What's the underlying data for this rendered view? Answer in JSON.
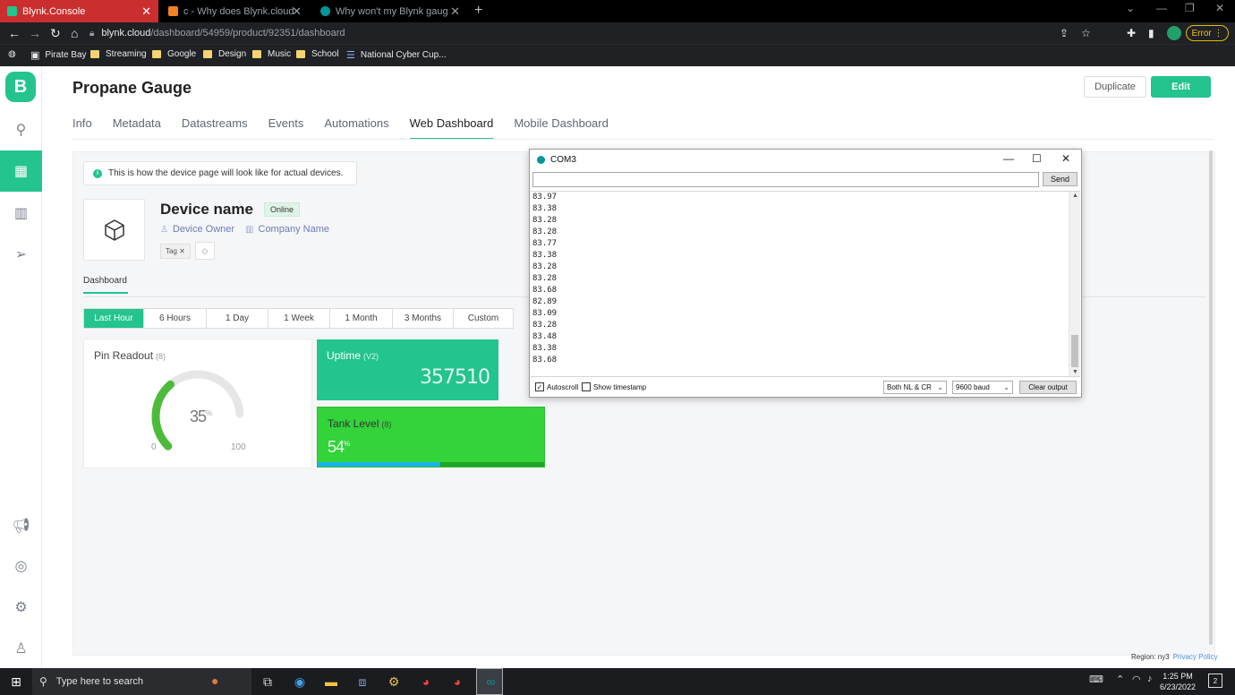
{
  "browser": {
    "tabs": [
      {
        "title": "Blynk.Console",
        "active": true
      },
      {
        "title": "c - Why does Blynk.cloud not co",
        "active": false
      },
      {
        "title": "Why won't my Blynk gauge widg",
        "active": false
      }
    ],
    "url_host": "blynk.cloud",
    "url_path": "/dashboard/54959/product/92351/dashboard",
    "error_label": "Error",
    "bookmarks": [
      "Pirate Bay",
      "Streaming",
      "Google",
      "Design",
      "Music",
      "School",
      "National Cyber Cup..."
    ]
  },
  "sidebar": {
    "logo": "B"
  },
  "page": {
    "title": "Propane Gauge",
    "duplicate_label": "Duplicate",
    "edit_label": "Edit",
    "tabs": [
      "Info",
      "Metadata",
      "Datastreams",
      "Events",
      "Automations",
      "Web Dashboard",
      "Mobile Dashboard"
    ],
    "active_tab": "Web Dashboard"
  },
  "device": {
    "notice": "This is how the device page will look like for actual devices.",
    "name": "Device name",
    "status": "Online",
    "owner": "Device Owner",
    "company": "Company Name",
    "tag": "Tag",
    "dashboard_tab": "Dashboard",
    "time_ranges": [
      "Last Hour",
      "6 Hours",
      "1 Day",
      "1 Week",
      "1 Month",
      "3 Months",
      "Custom"
    ],
    "active_range": "Last Hour"
  },
  "widgets": {
    "pin_readout": {
      "title": "Pin Readout",
      "pin": "(8)",
      "value": "35",
      "unit": "%",
      "min": "0",
      "max": "100",
      "level": 0.35
    },
    "uptime": {
      "title": "Uptime",
      "pin": "(V2)",
      "value": "357510"
    },
    "tank_level": {
      "title": "Tank Level",
      "pin": "(8)",
      "value": "54",
      "unit": "%",
      "level": 0.54
    }
  },
  "serial_monitor": {
    "title": "COM3",
    "send_label": "Send",
    "output": [
      "83.97",
      "83.38",
      "83.28",
      "83.28",
      "83.77",
      "83.38",
      "83.28",
      "83.28",
      "83.68",
      "82.89",
      "83.09",
      "83.28",
      "83.48",
      "83.38",
      "83.68"
    ],
    "autoscroll_label": "Autoscroll",
    "autoscroll_checked": true,
    "timestamp_label": "Show timestamp",
    "timestamp_checked": false,
    "line_ending": "Both NL & CR",
    "baud": "9600 baud",
    "clear_label": "Clear output"
  },
  "footer": {
    "region": "Region: ny3",
    "privacy": "Privacy Policy"
  },
  "taskbar": {
    "search_placeholder": "Type here to search",
    "time": "1:25 PM",
    "date": "6/23/2022",
    "notifications": "2"
  },
  "colors": {
    "brand": "#23c48e",
    "tank_widget": "#33d33a",
    "tank_fill": "#17b4e9",
    "browser_tab_active": "#cb2e2e"
  }
}
